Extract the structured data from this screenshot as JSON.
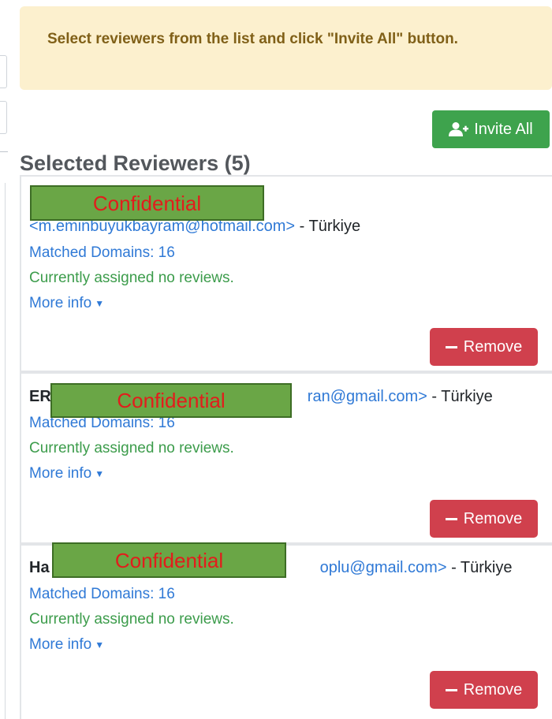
{
  "notice": {
    "text": "Select reviewers from the list and click \"Invite All\" button."
  },
  "invite_button": {
    "label": "Invite All",
    "icon": "user-plus-icon",
    "color": "#3ea34d"
  },
  "selected_heading": "Selected Reviewers (5)",
  "redaction_label": "Confidential",
  "reviewers": [
    {
      "name_partial": "",
      "email_partial": "<m.eminbuyukbayram@hotmail.com>",
      "country": " - Türkiye",
      "matched": "Matched Domains: 16",
      "assigned": "Currently assigned no reviews.",
      "more_info": "More info",
      "remove_label": "Remove"
    },
    {
      "name_partial": "ER",
      "email_partial": "ran@gmail.com>",
      "country": " - Türkiye",
      "matched": "Matched Domains: 16",
      "assigned": "Currently assigned no reviews.",
      "more_info": "More info",
      "remove_label": "Remove"
    },
    {
      "name_partial": "Ha",
      "email_partial": "oplu@gmail.com>",
      "country": " - Türkiye",
      "matched": "Matched Domains: 16",
      "assigned": "Currently assigned no reviews.",
      "more_info": "More info",
      "remove_label": "Remove"
    }
  ],
  "colors": {
    "remove": "#d0404d",
    "notice_bg": "#fcf0ce",
    "link": "#2f79d6",
    "success": "#3c9c4b"
  }
}
